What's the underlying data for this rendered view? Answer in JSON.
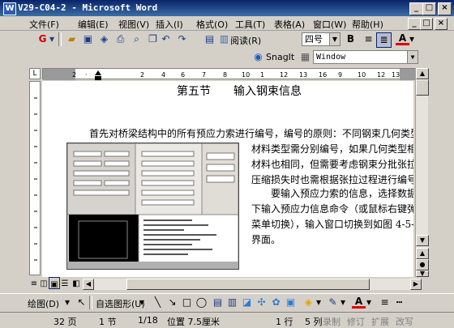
{
  "window": {
    "title": "V29-C04-2 - Microsoft Word"
  },
  "menu": [
    "文件(F)",
    "编辑(E)",
    "视图(V)",
    "插入(I)",
    "格式(O)",
    "工具(T)",
    "表格(A)",
    "窗口(W)",
    "帮助(H)"
  ],
  "toolbar": {
    "read_label": "阅读(R)",
    "font_size": "四号",
    "bold_label": "B",
    "snagit_label": "SnagIt",
    "window_combo": "Window"
  },
  "document": {
    "heading": "第五节　　输入钢束信息",
    "para1_line1": "首先对桥梁结构中的所有预应力索进行编号，编号的原则：不同钢束几何类型、",
    "para1_line2": "材料类型需分别编号，如果几何类型相",
    "para1_line3": "材料也相同，但需要考虑钢束分批张拉",
    "para1_line4": "压缩损失时也需根据张拉过程进行编号。",
    "para2_line1": "要输入预应力索的信息，选择数据",
    "para2_line2": "下输入预应力信息命令（或鼠标右键弹",
    "para2_line3": "菜单切换），输入窗口切换到如图 4-5-1",
    "para2_line4": "界面。"
  },
  "drawbar": {
    "draw_label": "绘图(D)",
    "autoshape_label": "自选图形(U)"
  },
  "status": {
    "page": "32 页",
    "section": "1 节",
    "page_of": "1/18",
    "position": "位置 7.5厘米",
    "line": "1 行",
    "column": "5 列",
    "rec": "录制",
    "trk": "修订",
    "ext": "扩展",
    "ovr": "改写"
  }
}
